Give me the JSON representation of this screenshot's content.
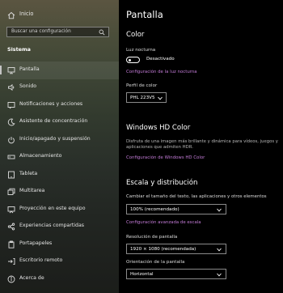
{
  "sidebar": {
    "home_label": "Inicio",
    "search_placeholder": "Buscar una configuración",
    "section_title": "Sistema",
    "items": [
      {
        "label": "Pantalla",
        "icon": "monitor-icon",
        "selected": true
      },
      {
        "label": "Sonido",
        "icon": "speaker-icon"
      },
      {
        "label": "Notificaciones y acciones",
        "icon": "notification-icon"
      },
      {
        "label": "Asistente de concentración",
        "icon": "moon-icon"
      },
      {
        "label": "Inicio/apagado y suspensión",
        "icon": "power-icon"
      },
      {
        "label": "Almacenamiento",
        "icon": "storage-icon"
      },
      {
        "label": "Tableta",
        "icon": "tablet-icon"
      },
      {
        "label": "Multitarea",
        "icon": "multitask-icon"
      },
      {
        "label": "Proyección en este equipo",
        "icon": "projection-icon"
      },
      {
        "label": "Experiencias compartidas",
        "icon": "share-icon"
      },
      {
        "label": "Portapapeles",
        "icon": "clipboard-icon"
      },
      {
        "label": "Escritorio remoto",
        "icon": "remote-desktop-icon"
      },
      {
        "label": "Acerca de",
        "icon": "info-icon"
      }
    ]
  },
  "main": {
    "title": "Pantalla",
    "color": {
      "heading": "Color",
      "night_light_label": "Luz nocturna",
      "night_light_state": "Desactivado",
      "night_light_link": "Configuración de la luz nocturna",
      "profile_label": "Perfil de color",
      "profile_value": "PHL 223V5"
    },
    "hd_color": {
      "heading": "Windows HD Color",
      "description": "Disfruta de una imagen más brillante y dinámica para vídeos, juegos y aplicaciones que admiten HDR.",
      "link": "Configuración de Windows HD Color"
    },
    "scale": {
      "heading": "Escala y distribución",
      "size_label": "Cambiar el tamaño del texto, las aplicaciones y otros elementos",
      "size_value": "100% (recomendado)",
      "advanced_link": "Configuración avanzada de escala",
      "resolution_label": "Resolución de pantalla",
      "resolution_value": "1920 × 1080 (recomendada)",
      "orientation_label": "Orientación de la pantalla",
      "orientation_value": "Horizontal"
    }
  },
  "colors": {
    "link": "#c27bd6",
    "background": "#000000"
  }
}
